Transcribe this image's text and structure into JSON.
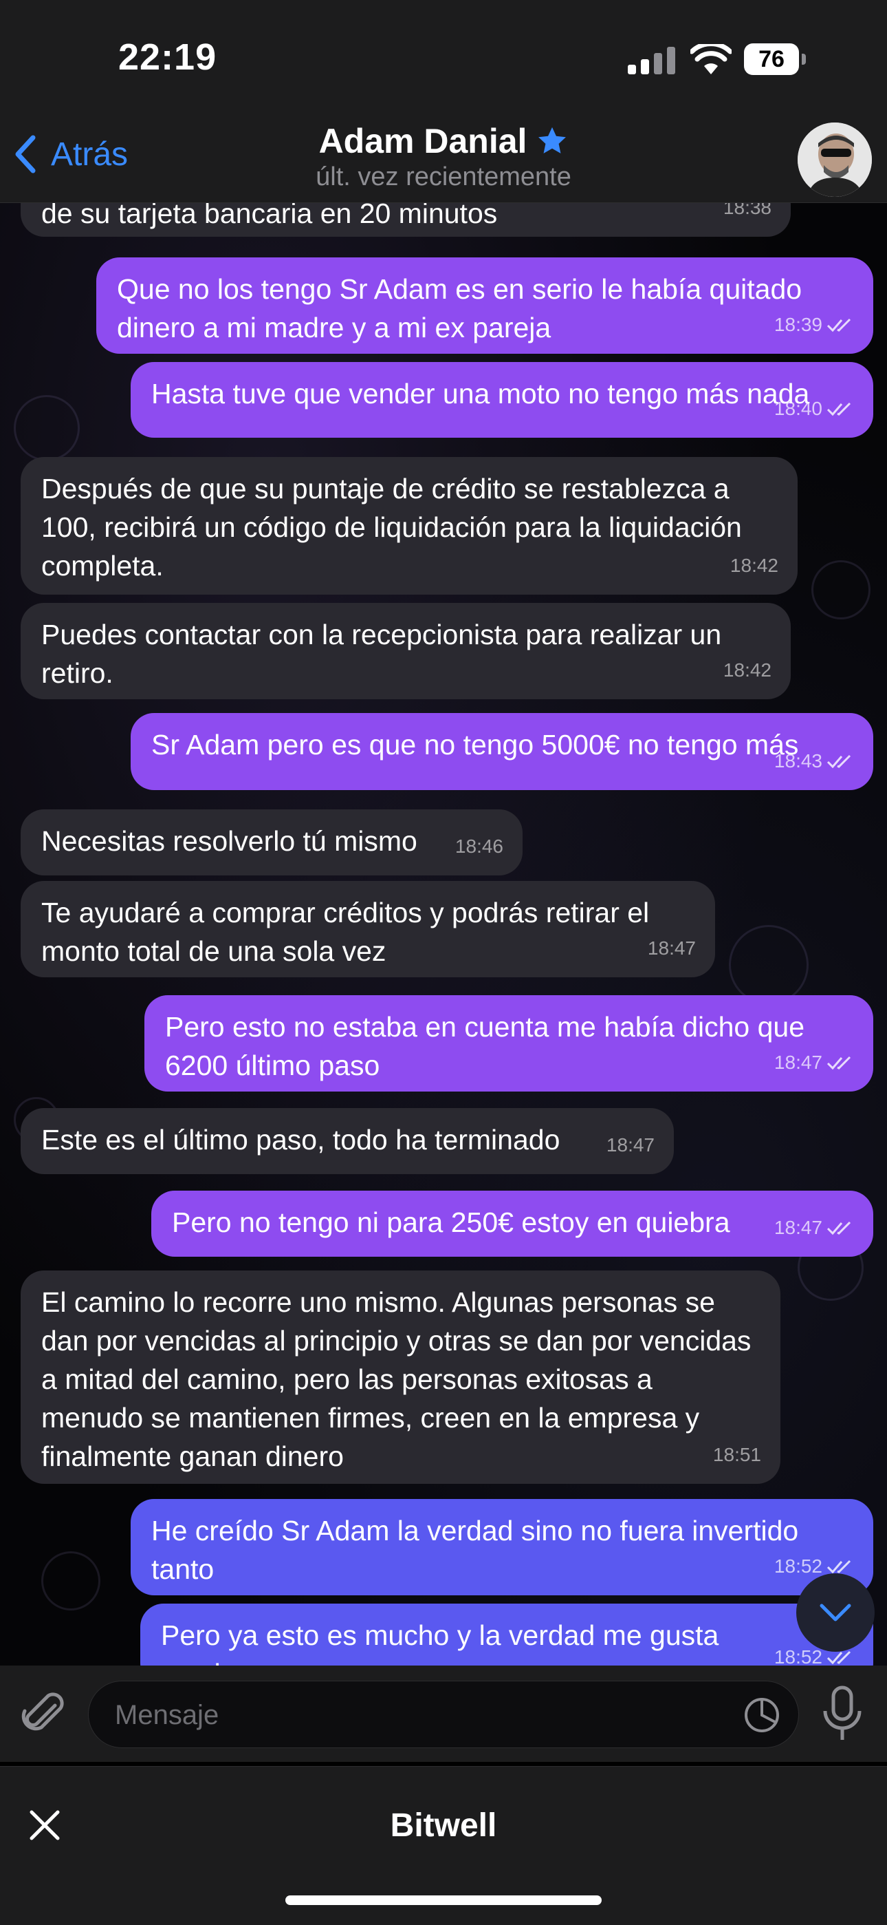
{
  "status_bar": {
    "time": "22:19",
    "battery": "76"
  },
  "header": {
    "back_label": "Atrás",
    "contact_name": "Adam Danial",
    "last_seen": "últ. vez recientemente"
  },
  "messages": [
    {
      "dir": "in",
      "text": "de su tarjeta bancaria en 20 minutos",
      "time": "18:38"
    },
    {
      "dir": "out",
      "text": "Que no los tengo Sr Adam es en serio le había quitado dinero a mi madre y a mi ex pareja",
      "time": "18:39"
    },
    {
      "dir": "out",
      "text": "Hasta tuve que vender una moto no tengo más nada",
      "time": "18:40"
    },
    {
      "dir": "in",
      "text": "Después de que su puntaje de crédito se restablezca a 100, recibirá un código de liquidación para la liquidación completa.",
      "time": "18:42"
    },
    {
      "dir": "in",
      "text": "Puedes contactar con la recepcionista para realizar un retiro.",
      "time": "18:42"
    },
    {
      "dir": "out",
      "text": "Sr Adam pero es que no tengo 5000€ no tengo más",
      "time": "18:43"
    },
    {
      "dir": "in",
      "text": "Necesitas resolverlo tú mismo",
      "time": "18:46"
    },
    {
      "dir": "in",
      "text": "Te ayudaré a comprar créditos y podrás retirar el monto total de una sola vez",
      "time": "18:47"
    },
    {
      "dir": "out",
      "text": "Pero esto no estaba en cuenta me había dicho que 6200 último paso",
      "time": "18:47"
    },
    {
      "dir": "in",
      "text": "Este es el último paso, todo ha terminado",
      "time": "18:47"
    },
    {
      "dir": "out",
      "text": "Pero no tengo ni para 250€ estoy en quiebra",
      "time": "18:47"
    },
    {
      "dir": "in",
      "text": "El camino lo recorre uno mismo. Algunas personas se dan por vencidas al principio y otras se dan por vencidas a mitad del camino, pero las personas exitosas a menudo se mantienen firmes, creen en la empresa y finalmente ganan dinero",
      "time": "18:51"
    },
    {
      "dir": "out",
      "text": "He creído Sr Adam la verdad sino no fuera invertido tanto",
      "time": "18:52"
    },
    {
      "dir": "out",
      "text": "Pero ya esto es mucho y la verdad me gusta mucho",
      "time": "18:52"
    }
  ],
  "composer": {
    "placeholder": "Mensaje"
  },
  "bottom_sheet": {
    "title": "Bitwell"
  },
  "icons": [
    "signal-icon",
    "wifi-icon",
    "battery-icon",
    "chevron-left-icon",
    "star-icon",
    "paperclip-icon",
    "sticker-icon",
    "microphone-icon",
    "chevron-down-icon",
    "close-icon",
    "double-check-icon"
  ],
  "colors": {
    "accent": "#3a8bff",
    "outgoing_bubble": "#8e4cf0",
    "outgoing_bubble_blue": "#5a59f0",
    "incoming_bubble": "#2a2930"
  }
}
